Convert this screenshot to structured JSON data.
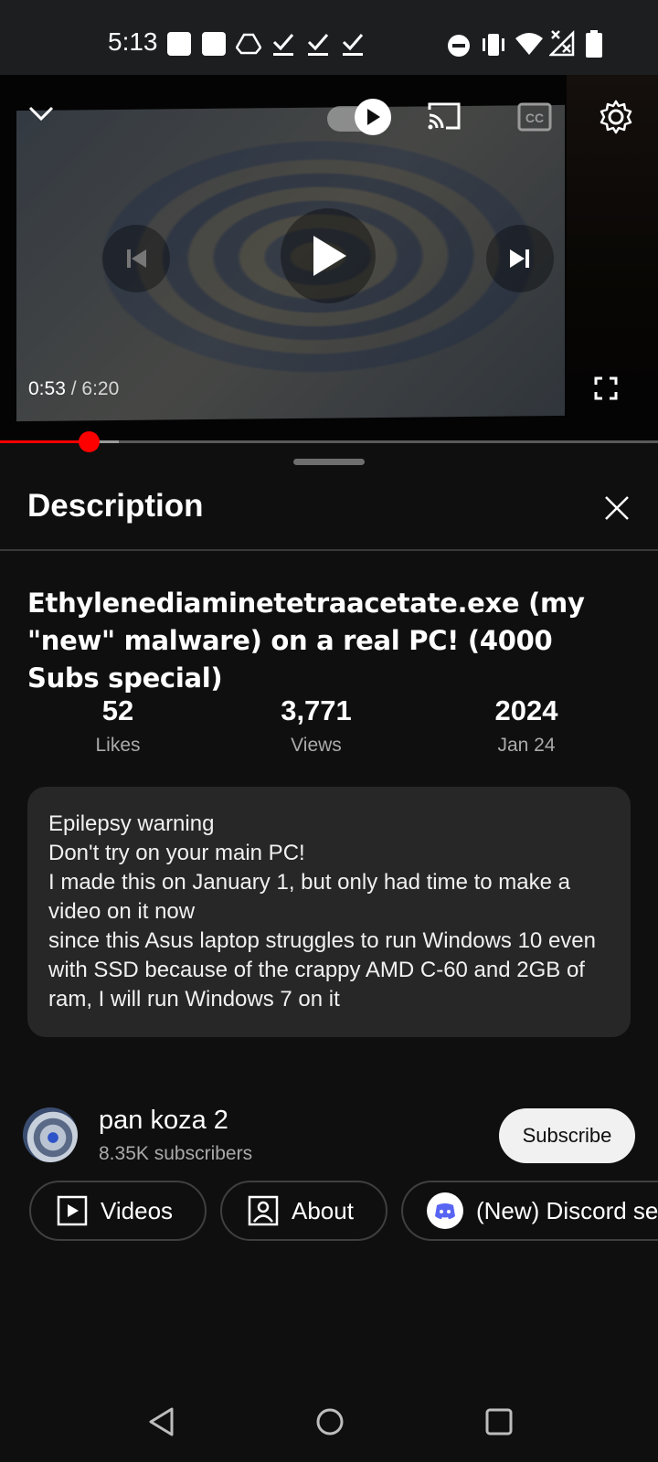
{
  "status_bar": {
    "time": "5:13",
    "icons": [
      "notification-square-icon",
      "notification-square-icon",
      "drive-icon",
      "check-icon",
      "check-icon",
      "check-icon",
      "do-not-disturb-icon",
      "vibrate-icon",
      "wifi-icon",
      "no-signal-icon",
      "battery-icon"
    ]
  },
  "player": {
    "current_time": "0:53",
    "separator": " / ",
    "duration": "6:20",
    "progress_fraction": 0.139,
    "buffered_fraction": 0.18
  },
  "description_panel": {
    "heading": "Description",
    "video_title": "Ethylenediaminetetraacetate.exe (my \"new\" malware) on a real PC! (4000 Subs special)",
    "stats": {
      "likes": {
        "value": "52",
        "label": "Likes"
      },
      "views": {
        "value": "3,771",
        "label": "Views"
      },
      "date": {
        "value": "2024",
        "label": "Jan 24"
      }
    },
    "description_text": "Epilepsy warning\nDon't try on your main PC!\nI made this on January 1, but only had time to make a video on it now\nsince this Asus laptop struggles to run Windows 10 even with SSD because of the crappy AMD C-60 and 2GB of ram, I will run Windows 7 on it"
  },
  "channel": {
    "name": "pan koza 2",
    "subscribers": "8.35K subscribers",
    "subscribe_label": "Subscribe",
    "chips": [
      {
        "label": "Videos",
        "icon": "video-icon"
      },
      {
        "label": "About",
        "icon": "person-icon"
      },
      {
        "label": "(New) Discord se",
        "icon": "discord-icon"
      }
    ]
  },
  "colors": {
    "accent": "#ff0000",
    "background": "#0f0f0f",
    "card": "#272727",
    "secondary_text": "#aaaaaa"
  }
}
